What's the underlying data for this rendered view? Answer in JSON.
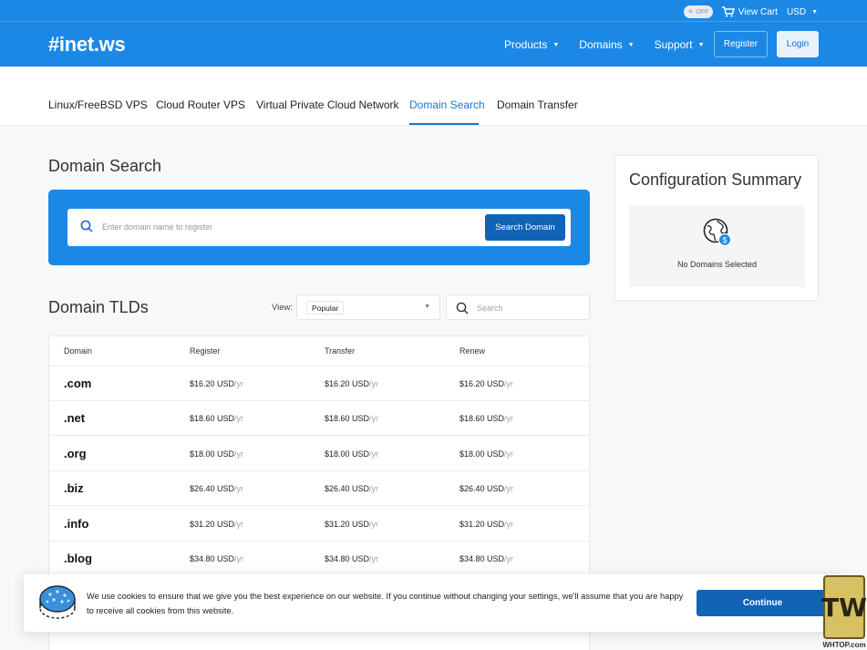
{
  "topbar": {
    "toggle": {
      "icon": "sun-icon",
      "label": "OFF"
    },
    "cart": {
      "icon": "cart-icon",
      "label": "View Cart"
    },
    "currency": "USD"
  },
  "header": {
    "logo": "#inet.ws",
    "nav": [
      {
        "label": "Products"
      },
      {
        "label": "Domains"
      },
      {
        "label": "Support"
      }
    ],
    "register_label": "Register",
    "login_label": "Login"
  },
  "subnav": {
    "tabs": [
      {
        "label": "Linux/FreeBSD VPS"
      },
      {
        "label": "Cloud Router VPS"
      },
      {
        "label": "Virtual Private Cloud Network"
      },
      {
        "label": "Domain Search",
        "active": true
      },
      {
        "label": "Domain Transfer"
      }
    ]
  },
  "domain_search": {
    "title": "Domain Search",
    "placeholder": "Enter domain name to register",
    "button": "Search Domain"
  },
  "tlds": {
    "title": "Domain TLDs",
    "view_label": "View:",
    "view_value": "Popular",
    "search_placeholder": "Search",
    "columns": [
      "Domain",
      "Register",
      "Transfer",
      "Renew"
    ],
    "per": "/yr",
    "rows": [
      {
        "tld": ".com",
        "register": "$16.20 USD",
        "transfer": "$16.20 USD",
        "renew": "$16.20 USD"
      },
      {
        "tld": ".net",
        "register": "$18.60 USD",
        "transfer": "$18.60 USD",
        "renew": "$18.60 USD"
      },
      {
        "tld": ".org",
        "register": "$18.00 USD",
        "transfer": "$18.00 USD",
        "renew": "$18.00 USD"
      },
      {
        "tld": ".biz",
        "register": "$26.40 USD",
        "transfer": "$26.40 USD",
        "renew": "$26.40 USD"
      },
      {
        "tld": ".info",
        "register": "$31.20 USD",
        "transfer": "$31.20 USD",
        "renew": "$31.20 USD"
      },
      {
        "tld": ".blog",
        "register": "$34.80 USD",
        "transfer": "$34.80 USD",
        "renew": "$34.80 USD"
      }
    ]
  },
  "config_summary": {
    "title": "Configuration Summary",
    "empty_text": "No Domains Selected"
  },
  "cookie": {
    "text": "We use cookies to ensure that we give you the best experience on our website. If you continue without changing your settings, we'll assume that you are happy to receive all cookies from this website.",
    "button": "Continue"
  },
  "watermark": {
    "logo_text": "TW",
    "site": "WHTOP.com"
  },
  "colors": {
    "brand_blue": "#1c88e6",
    "dark_blue": "#1163b6",
    "active_tab": "#1c76d4"
  }
}
